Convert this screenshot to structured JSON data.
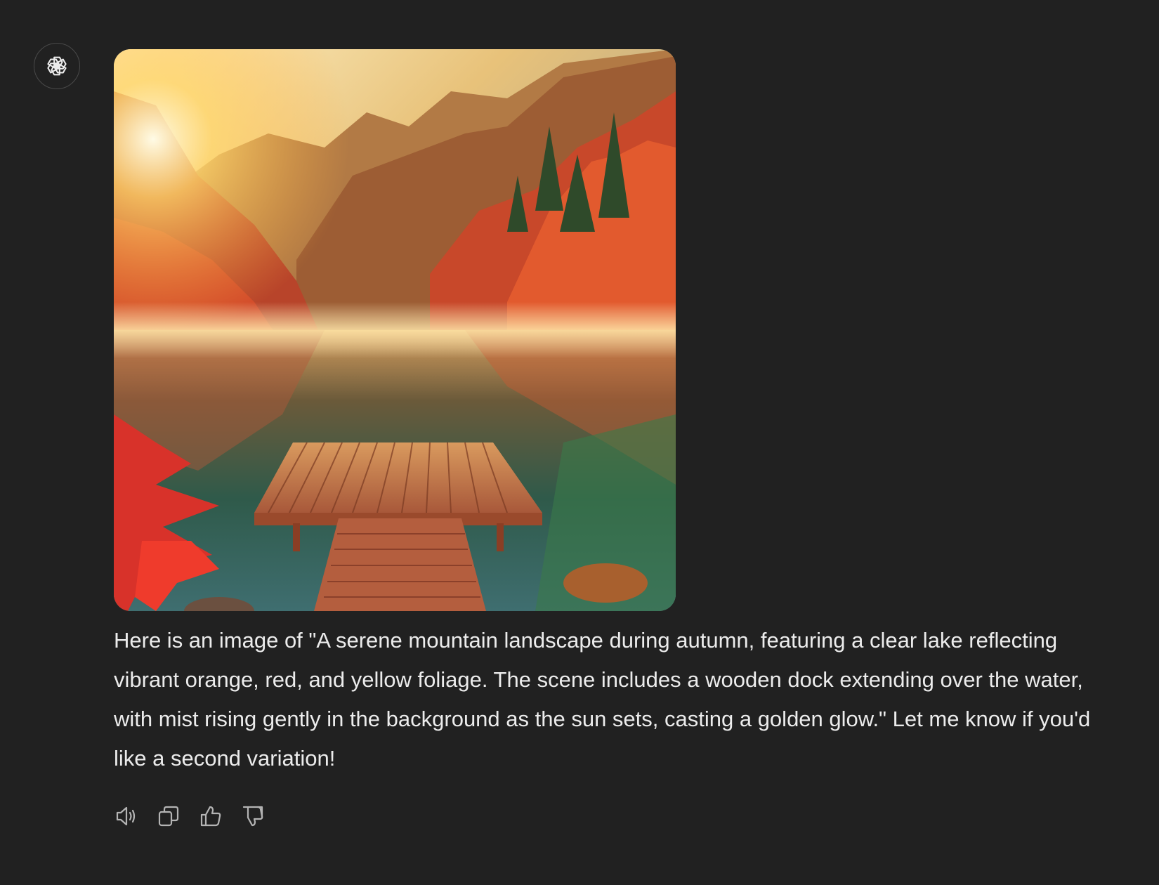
{
  "assistant": {
    "avatar_icon": "openai-logo-icon"
  },
  "image": {
    "alt": "Generated image"
  },
  "message": {
    "text": "Here is an image of \"A serene mountain landscape during autumn, featuring a clear lake reflecting vibrant orange, red, and yellow foliage. The scene includes a wooden dock extending over the water, with mist rising gently in the background as the sun sets, casting a golden glow.\" Let me know if you'd like a second variation!"
  },
  "actions": [
    {
      "name": "read-aloud-button",
      "icon": "speaker-icon"
    },
    {
      "name": "copy-button",
      "icon": "copy-icon"
    },
    {
      "name": "thumbs-up-button",
      "icon": "thumbs-up-icon"
    },
    {
      "name": "thumbs-down-button",
      "icon": "thumbs-down-icon"
    }
  ],
  "colors": {
    "background": "#212121",
    "text": "#ececec",
    "icon": "#b4b4b4"
  }
}
